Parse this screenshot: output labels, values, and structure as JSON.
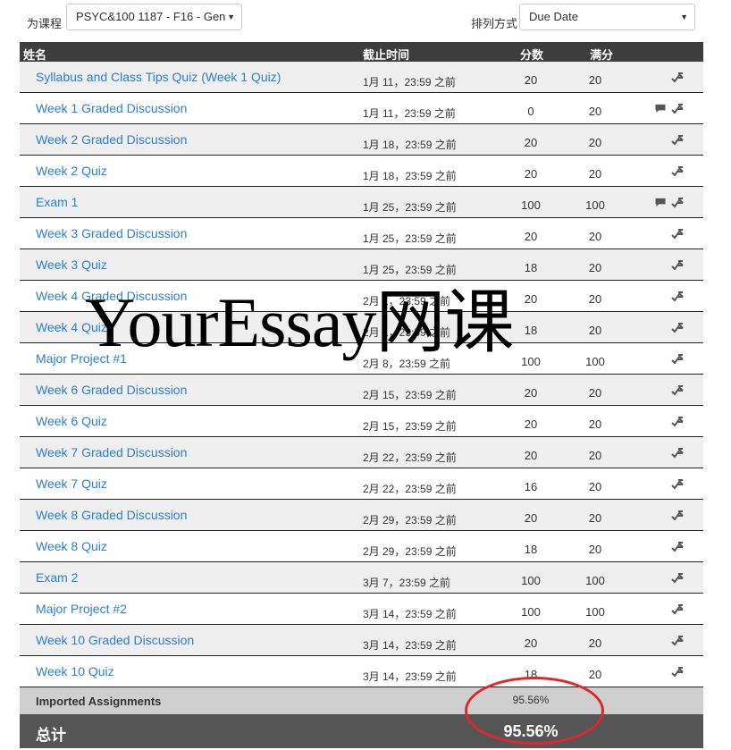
{
  "controls": {
    "course_label": "为课程",
    "course_value": "PSYC&100 1187 - F16 - Gen",
    "sort_label": "排列方式",
    "sort_value": "Due Date"
  },
  "table": {
    "headers": {
      "name": "姓名",
      "due": "截止时间",
      "score": "分数",
      "out_of": "满分"
    },
    "rows": [
      {
        "name": "Syllabus and Class Tips Quiz (Week 1 Quiz)",
        "due": "1月 11，23:59 之前",
        "score": "20",
        "out_of": "20",
        "comment": false
      },
      {
        "name": "Week 1 Graded Discussion",
        "due": "1月 11，23:59 之前",
        "score": "0",
        "out_of": "20",
        "comment": true
      },
      {
        "name": "Week 2 Graded Discussion",
        "due": "1月 18，23:59 之前",
        "score": "20",
        "out_of": "20",
        "comment": false
      },
      {
        "name": "Week 2 Quiz",
        "due": "1月 18，23:59 之前",
        "score": "20",
        "out_of": "20",
        "comment": false
      },
      {
        "name": "Exam 1",
        "due": "1月 25，23:59 之前",
        "score": "100",
        "out_of": "100",
        "comment": true
      },
      {
        "name": "Week 3 Graded Discussion",
        "due": "1月 25，23:59 之前",
        "score": "20",
        "out_of": "20",
        "comment": false
      },
      {
        "name": "Week 3 Quiz",
        "due": "1月 25，23:59 之前",
        "score": "18",
        "out_of": "20",
        "comment": false
      },
      {
        "name": "Week 4 Graded Discussion",
        "due": "2月 1，23:59 之前",
        "score": "20",
        "out_of": "20",
        "comment": false
      },
      {
        "name": "Week 4 Quiz",
        "due": "2月 1，23:59 之前",
        "score": "18",
        "out_of": "20",
        "comment": false
      },
      {
        "name": "Major Project #1",
        "due": "2月 8，23:59 之前",
        "score": "100",
        "out_of": "100",
        "comment": false
      },
      {
        "name": "Week 6 Graded Discussion",
        "due": "2月 15，23:59 之前",
        "score": "20",
        "out_of": "20",
        "comment": false
      },
      {
        "name": "Week 6 Quiz",
        "due": "2月 15，23:59 之前",
        "score": "20",
        "out_of": "20",
        "comment": false
      },
      {
        "name": "Week 7 Graded Discussion",
        "due": "2月 22，23:59 之前",
        "score": "20",
        "out_of": "20",
        "comment": false
      },
      {
        "name": "Week 7 Quiz",
        "due": "2月 22，23:59 之前",
        "score": "16",
        "out_of": "20",
        "comment": false
      },
      {
        "name": "Week 8 Graded Discussion",
        "due": "2月 29，23:59 之前",
        "score": "20",
        "out_of": "20",
        "comment": false
      },
      {
        "name": "Week 8 Quiz",
        "due": "2月 29，23:59 之前",
        "score": "18",
        "out_of": "20",
        "comment": false
      },
      {
        "name": "Exam 2",
        "due": "3月 7，23:59 之前",
        "score": "100",
        "out_of": "100",
        "comment": false
      },
      {
        "name": "Major Project #2",
        "due": "3月 14，23:59 之前",
        "score": "100",
        "out_of": "100",
        "comment": false
      },
      {
        "name": "Week 10 Graded Discussion",
        "due": "3月 14，23:59 之前",
        "score": "20",
        "out_of": "20",
        "comment": false
      },
      {
        "name": "Week 10 Quiz",
        "due": "3月 14，23:59 之前",
        "score": "18",
        "out_of": "20",
        "comment": false
      }
    ],
    "imported": {
      "label": "Imported Assignments",
      "value": "95.56%"
    },
    "total": {
      "label": "总计",
      "value": "95.56%"
    }
  },
  "watermark": "YourEssay网课",
  "icons": {
    "comment": "comment-icon",
    "what_if": "what-if-icon"
  },
  "colors": {
    "link": "#2a7fd6",
    "header_bg": "#3d3d3d",
    "total_bg": "#555555",
    "annotation_circle": "#e0262b"
  }
}
